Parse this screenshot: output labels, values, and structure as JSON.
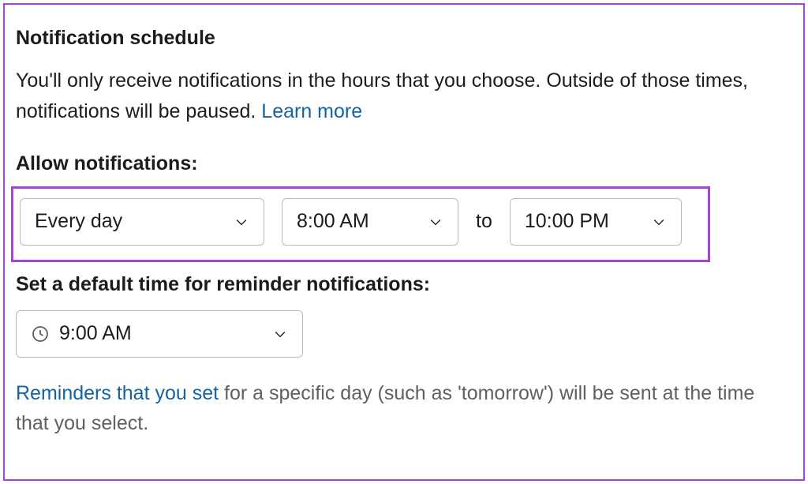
{
  "section": {
    "title": "Notification schedule",
    "description_part1": "You'll only receive notifications in the hours that you choose. Outside of those times, notifications will be paused. ",
    "learn_more": "Learn more"
  },
  "allow_notifications": {
    "label": "Allow notifications:",
    "days_value": "Every day",
    "start_time": "8:00 AM",
    "to_label": "to",
    "end_time": "10:00 PM"
  },
  "reminder": {
    "label": "Set a default time for reminder notifications:",
    "time_value": "9:00 AM",
    "footer_link": "Reminders that you set",
    "footer_rest": " for a specific day (such as 'tomorrow') will be sent at the time that you select."
  }
}
